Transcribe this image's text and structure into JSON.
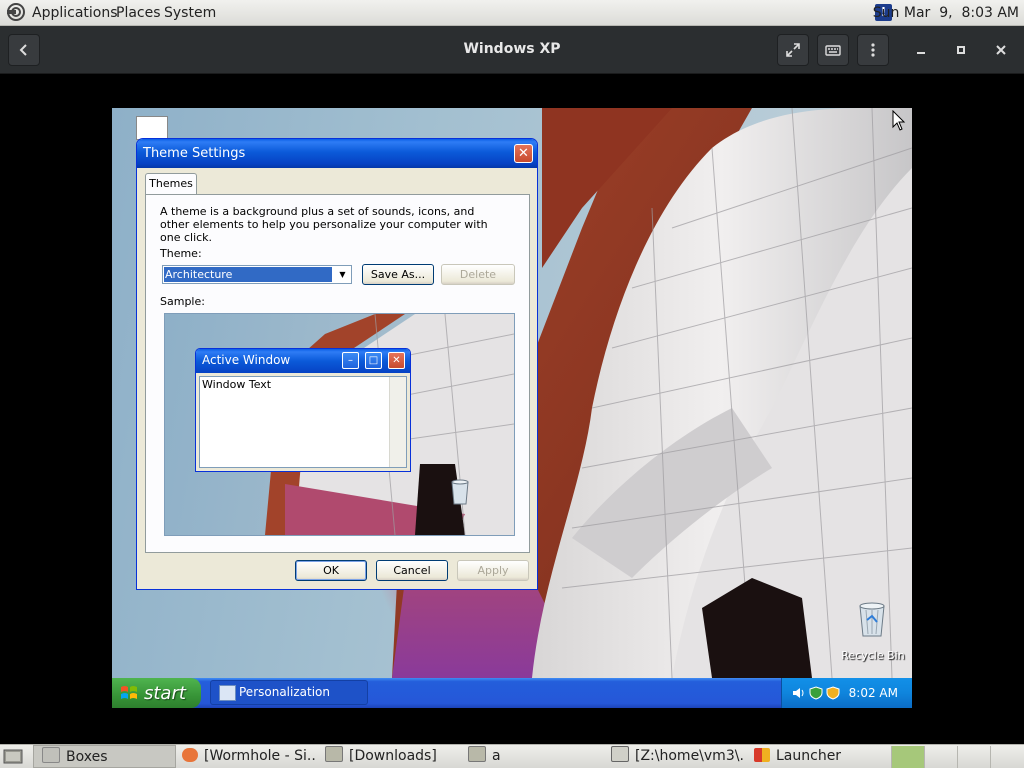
{
  "gnome_top": {
    "menus": [
      "Applications",
      "Places",
      "System"
    ],
    "clock": "Sun Mar  9,  8:03 AM"
  },
  "boxes_header": {
    "title": "Windows XP"
  },
  "xp": {
    "desktop_icons": {
      "recycle_bin": "Recycle Bin"
    },
    "dialog": {
      "title": "Theme Settings",
      "tab": "Themes",
      "description": "A theme is a background plus a set of sounds, icons, and other elements to help you personalize your computer with one click.",
      "theme_label": "Theme:",
      "theme_value": "Architecture",
      "save_as": "Save As...",
      "delete": "Delete",
      "sample_label": "Sample:",
      "sample_window_title": "Active Window",
      "sample_window_text": "Window Text",
      "ok": "OK",
      "cancel": "Cancel",
      "apply": "Apply"
    },
    "taskbar": {
      "start": "start",
      "task": "Personalization",
      "time": "8:02 AM"
    }
  },
  "gnome_bottom": {
    "tasks": [
      "Boxes",
      "[Wormhole - Si...",
      "[Downloads]",
      "a",
      "[Z:\\home\\vm3\\...",
      "Launcher"
    ]
  }
}
